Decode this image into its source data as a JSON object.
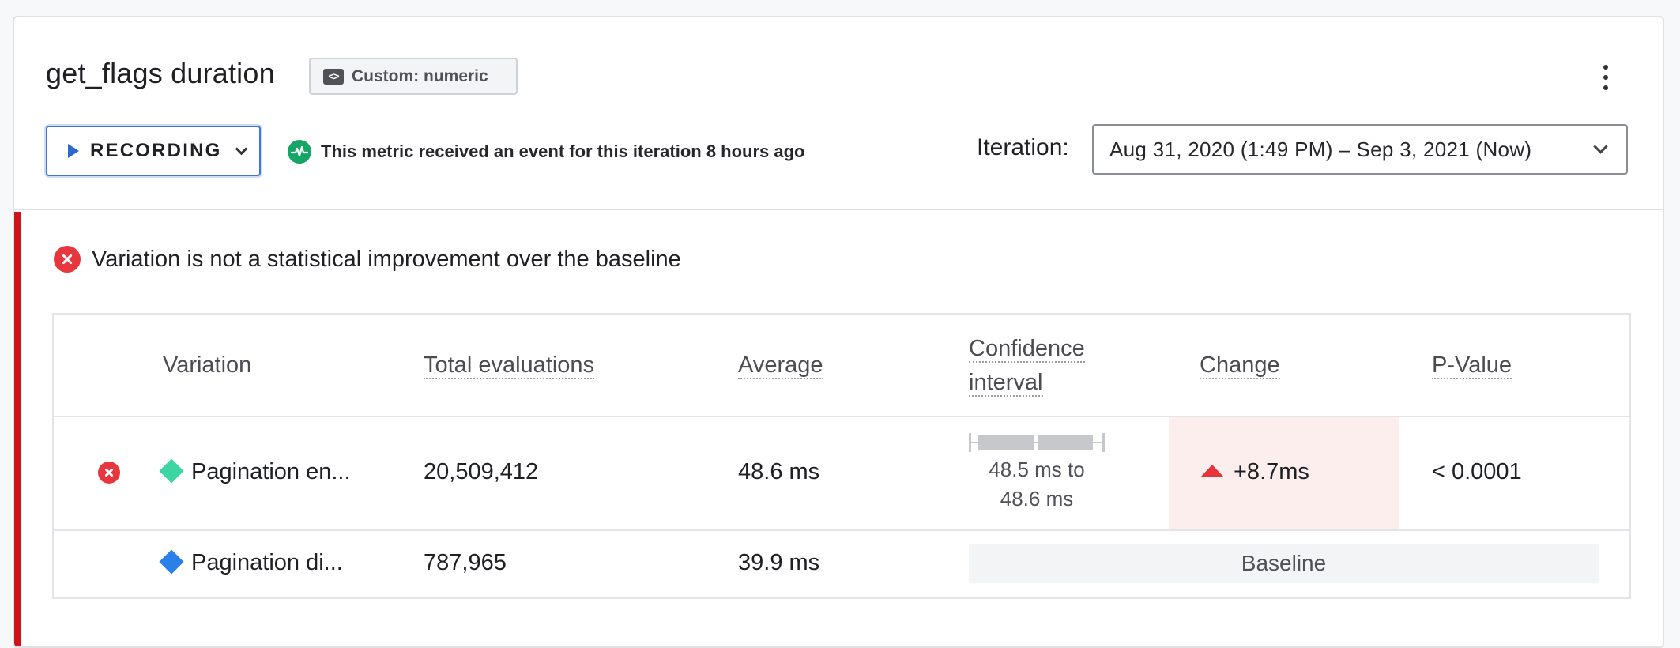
{
  "header": {
    "title": "get_flags duration",
    "badge": "Custom: numeric",
    "badge_icon": "code-icon",
    "more_icon": "kebab-menu-icon"
  },
  "recording": {
    "label": "RECORDING",
    "status_text": "This metric received an event for this iteration 8 hours ago"
  },
  "iteration": {
    "label": "Iteration:",
    "selected": "Aug 31, 2020 (1:49 PM) – Sep 3, 2021 (Now)"
  },
  "result": {
    "message": "Variation is not a statistical improvement over the baseline"
  },
  "table": {
    "headers": {
      "variation": "Variation",
      "total_evaluations": "Total evaluations",
      "average": "Average",
      "ci_line1": "Confidence",
      "ci_line2": "interval",
      "change": "Change",
      "p_value": "P-Value"
    },
    "rows": [
      {
        "name": "Pagination en...",
        "total": "20,509,412",
        "average": "48.6 ms",
        "ci_line1": "48.5 ms to",
        "ci_line2": "48.6 ms",
        "change": "+8.7ms",
        "p_value": "< 0.0001",
        "color": "#3dd6a3"
      },
      {
        "name": "Pagination di...",
        "total": "787,965",
        "average": "39.9 ms",
        "baseline": "Baseline",
        "color": "#2b7fe8"
      }
    ]
  },
  "colors": {
    "accent": "#2b68d1",
    "danger": "#d0121b",
    "success": "#17a565"
  }
}
